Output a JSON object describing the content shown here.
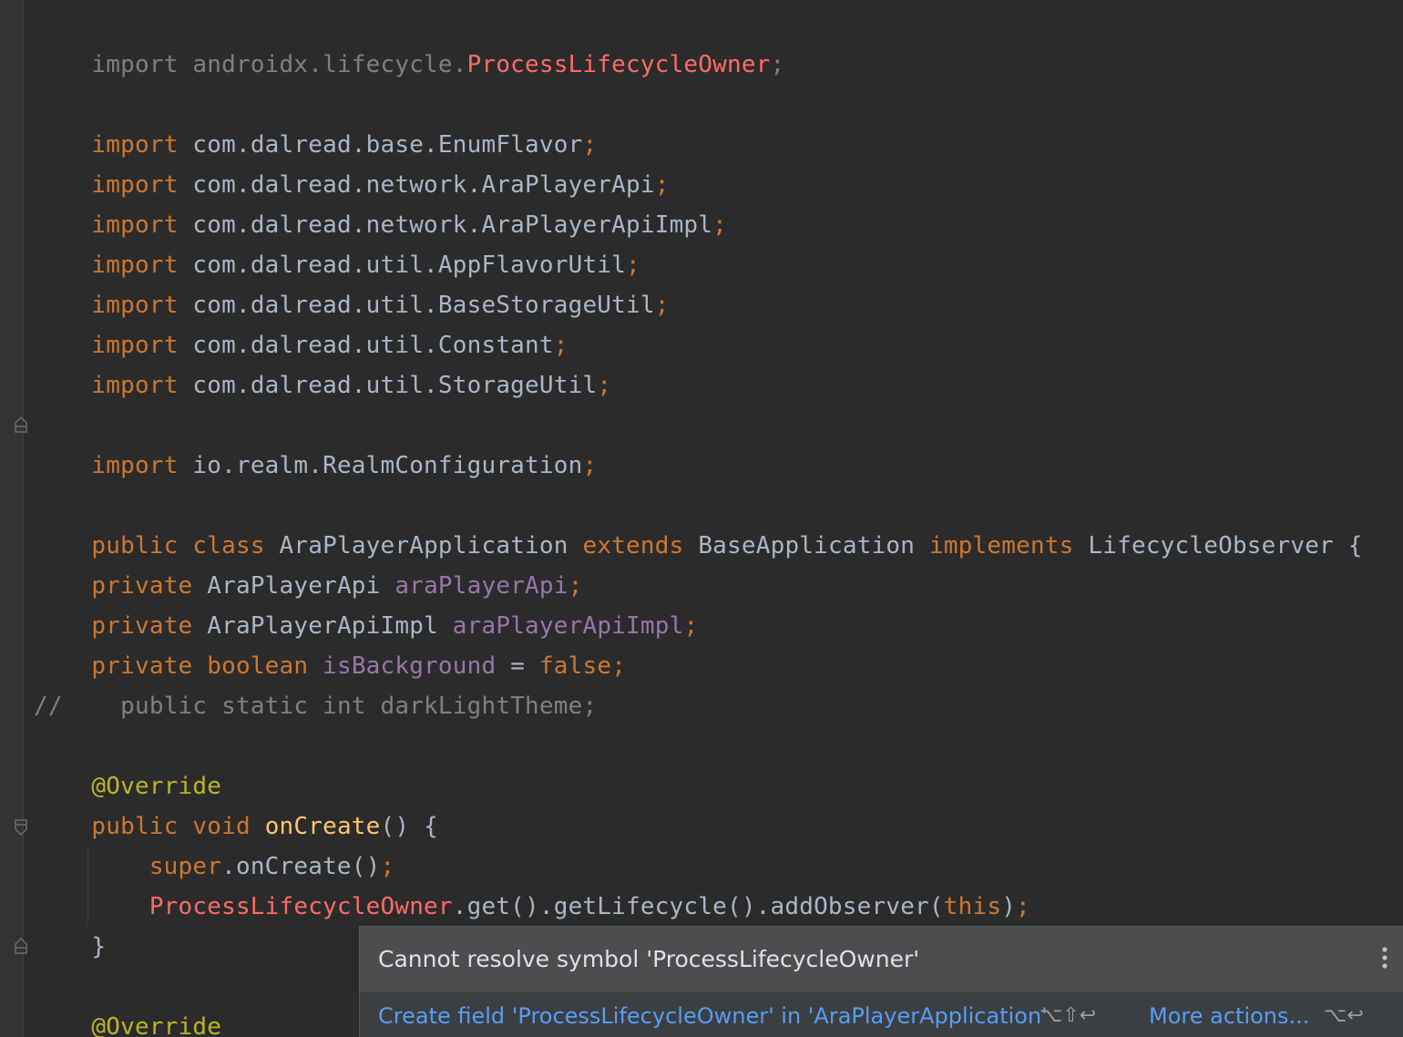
{
  "editor": {
    "lines": {
      "import_lifecycle": {
        "kw": "import",
        "pkg": "androidx.lifecycle.",
        "cls": "ProcessLifecycleOwner",
        "semi": ";"
      },
      "import_enumflavor": {
        "kw": "import",
        "text": "com.dalread.base.EnumFlavor",
        "semi": ";"
      },
      "import_arapi": {
        "kw": "import",
        "text": "com.dalread.network.AraPlayerApi",
        "semi": ";"
      },
      "import_arapiimpl": {
        "kw": "import",
        "text": "com.dalread.network.AraPlayerApiImpl",
        "semi": ";"
      },
      "import_appflavor": {
        "kw": "import",
        "text": "com.dalread.util.AppFlavorUtil",
        "semi": ";"
      },
      "import_basestorage": {
        "kw": "import",
        "text": "com.dalread.util.BaseStorageUtil",
        "semi": ";"
      },
      "import_constant": {
        "kw": "import",
        "text": "com.dalread.util.Constant",
        "semi": ";"
      },
      "import_storage": {
        "kw": "import",
        "text": "com.dalread.util.StorageUtil",
        "semi": ";"
      },
      "import_realm": {
        "kw": "import",
        "text": "io.realm.RealmConfiguration",
        "semi": ";"
      },
      "class_decl": {
        "kw_public": "public",
        "kw_class": "class",
        "name": "AraPlayerApplication",
        "kw_extends": "extends",
        "base": "BaseApplication",
        "kw_implements": "implements",
        "iface": "LifecycleObserver",
        "brace": "{"
      },
      "field_api": {
        "kw": "private",
        "type": "AraPlayerApi",
        "name": "araPlayerApi",
        "semi": ";"
      },
      "field_impl": {
        "kw": "private",
        "type": "AraPlayerApiImpl",
        "name": "araPlayerApiImpl",
        "semi": ";"
      },
      "field_bg": {
        "kw": "private",
        "type": "boolean",
        "name": "isBackground",
        "eq": "=",
        "value": "false",
        "semi": ";"
      },
      "comment": {
        "slashes": "//",
        "text": "public static int darkLightTheme;"
      },
      "override1": {
        "text": "@Override"
      },
      "oncreate_decl": {
        "kw_public": "public",
        "kw_void": "void",
        "name": "onCreate",
        "rest": "() {"
      },
      "super_call": {
        "kw": "super",
        "rest": ".onCreate()",
        "semi": ";"
      },
      "lifecycle_call": {
        "err": "ProcessLifecycleOwner",
        "rest": ".get().getLifecycle().addObserver(",
        "kw_this": "this",
        "close": ")",
        "semi": ";"
      },
      "close_brace": {
        "text": "}"
      },
      "override2": {
        "text": "@Override"
      }
    }
  },
  "popup": {
    "message": "Cannot resolve symbol 'ProcessLifecycleOwner'",
    "quick_fix": "Create field 'ProcessLifecycleOwner' in 'AraPlayerApplication'",
    "quick_fix_shortcut": "⌥⇧↩",
    "more_actions": "More actions...",
    "more_actions_shortcut": "⌥↩",
    "menu_icon": "vertical-ellipsis-icon"
  },
  "colors": {
    "background": "#2b2b2b",
    "keyword": "#cc7832",
    "plain": "#a9b7c6",
    "error": "#ff6b68",
    "field": "#9876aa",
    "comment": "#808080",
    "annotation": "#bbb529",
    "method": "#ffc66d",
    "link": "#589df6",
    "popup_bg": "#3c3f41",
    "popup_header_bg": "#4b4d4f"
  }
}
